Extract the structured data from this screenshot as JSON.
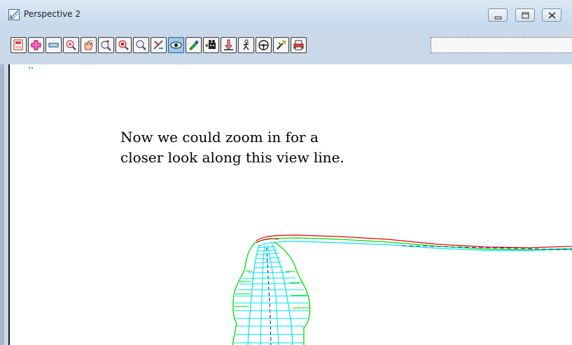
{
  "window": {
    "title": "Perspective 2",
    "controls": [
      "minimize",
      "maximize",
      "close"
    ]
  },
  "toolbar": {
    "buttons": [
      {
        "name": "plot-icon"
      },
      {
        "name": "zoom-in-plus-icon"
      },
      {
        "name": "zoom-out-minus-icon"
      },
      {
        "name": "zoom-window-icon"
      },
      {
        "name": "pan-hand-icon"
      },
      {
        "name": "zoom-point-icon"
      },
      {
        "name": "zoom-center-icon"
      },
      {
        "name": "zoom-search-icon"
      },
      {
        "name": "view-mode-icon"
      },
      {
        "name": "eye-view-icon",
        "active": true
      },
      {
        "name": "paint-icon"
      },
      {
        "name": "camera-icon"
      },
      {
        "name": "move-icon"
      },
      {
        "name": "walk-icon"
      },
      {
        "name": "drive-icon"
      },
      {
        "name": "tools-icon"
      },
      {
        "name": "print-icon"
      }
    ]
  },
  "viewport": {
    "caption_line1": "Now we could zoom in for a",
    "caption_line2": "closer look along this view line."
  },
  "colors": {
    "road_outline": "#00dd00",
    "road_mesh": "#00e5ee",
    "road_edge": "#e00000",
    "road_center": "#0000cc"
  }
}
